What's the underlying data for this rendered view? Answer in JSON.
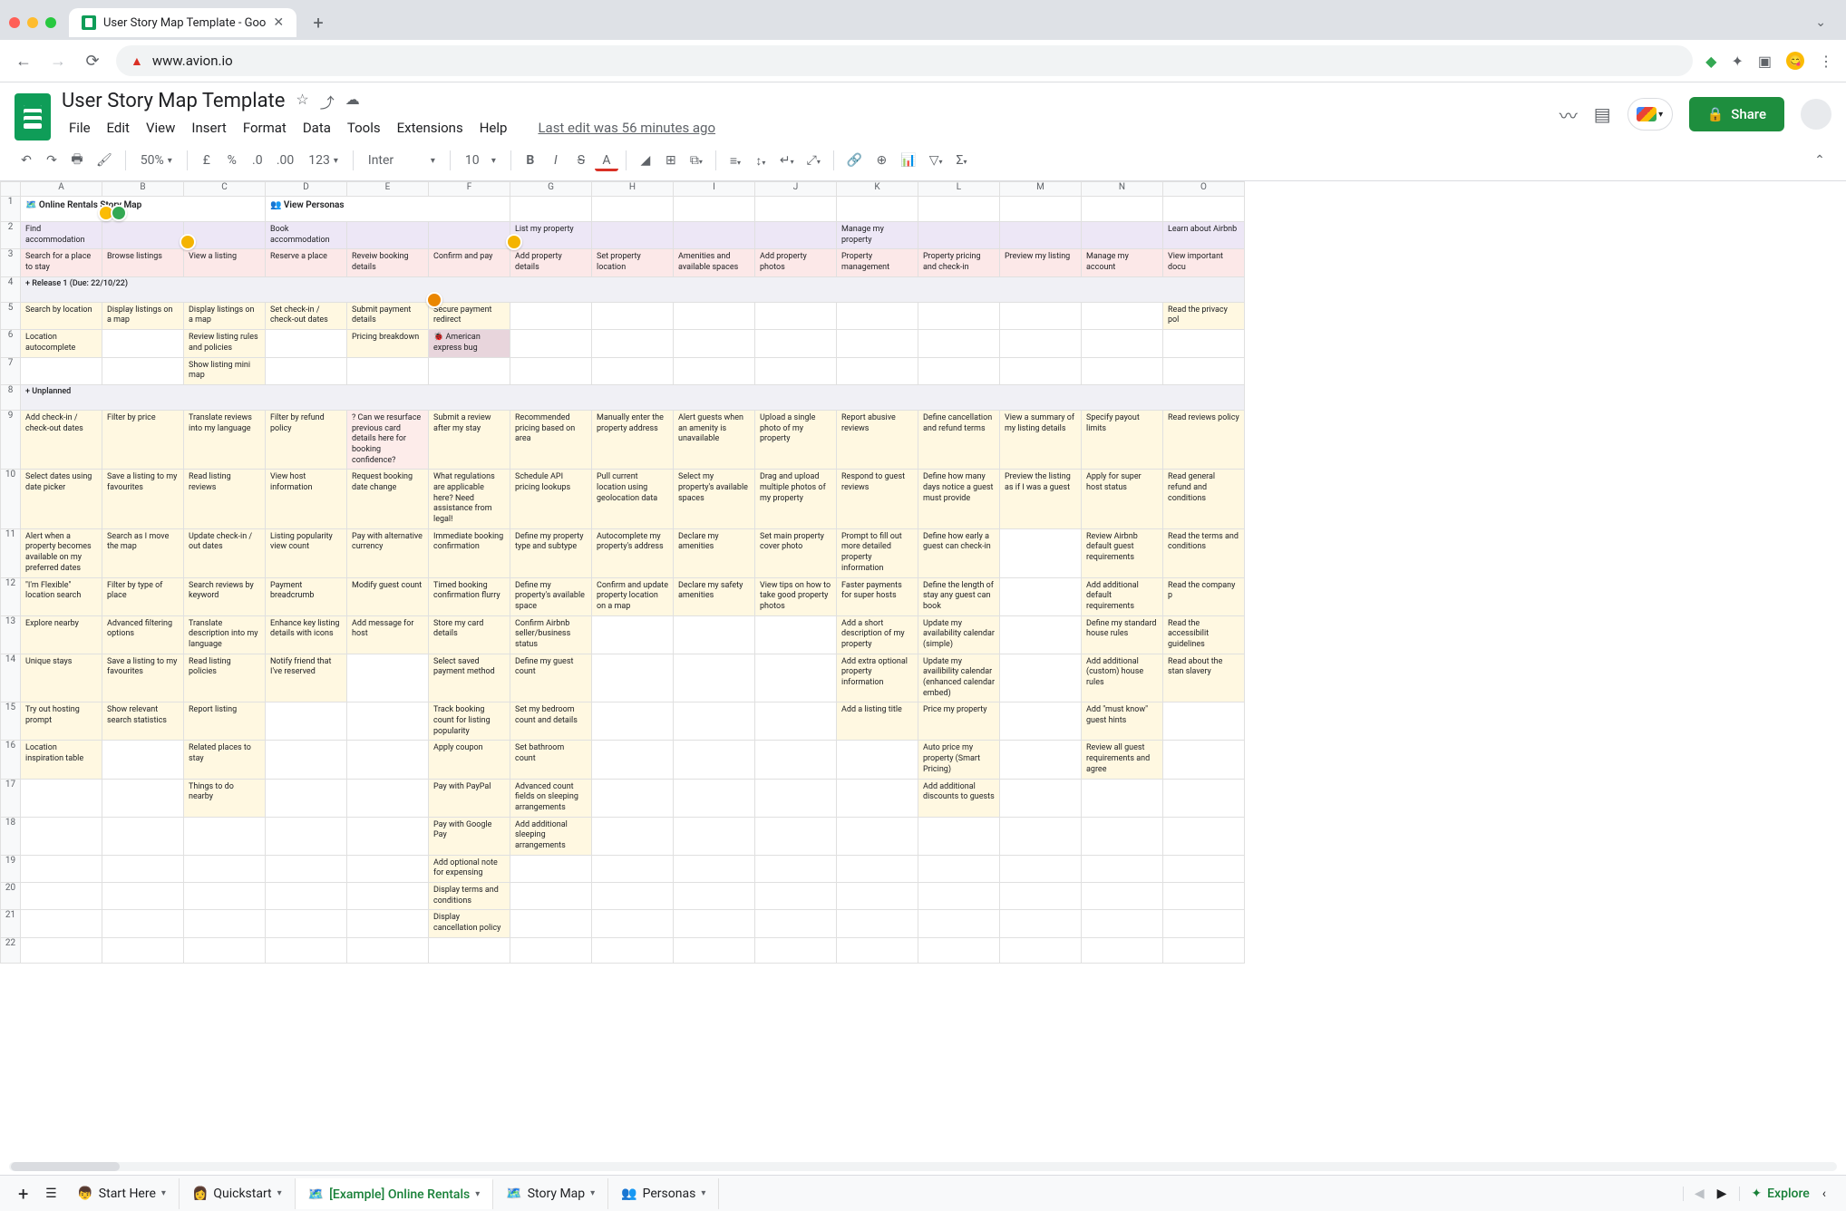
{
  "browser": {
    "tab_title": "User Story Map Template - Goo",
    "url": "www.avion.io"
  },
  "doc": {
    "title": "User Story Map Template",
    "menus": [
      "File",
      "Edit",
      "View",
      "Insert",
      "Format",
      "Data",
      "Tools",
      "Extensions",
      "Help"
    ],
    "last_edit": "Last edit was 56 minutes ago",
    "share_label": "Share"
  },
  "toolbar": {
    "zoom": "50%",
    "font": "Inter",
    "font_size": "10"
  },
  "columns": [
    "A",
    "B",
    "C",
    "D",
    "E",
    "F",
    "G",
    "H",
    "I",
    "J",
    "K",
    "L",
    "M",
    "N",
    "O"
  ],
  "map_title": "🗺️ Online Rentals Story Map",
  "personas_link": "👥 View Personas",
  "epics": [
    {
      "col": 0,
      "text": "Find accommodation"
    },
    {
      "col": 3,
      "text": "Book accommodation"
    },
    {
      "col": 6,
      "text": "List my property"
    },
    {
      "col": 10,
      "text": "Manage my property"
    },
    {
      "col": 14,
      "text": "Learn about Airbnb"
    }
  ],
  "activities": [
    "Search for a place to stay",
    "Browse listings",
    "View a listing",
    "Reserve a place",
    "Reveiw booking details",
    "Confirm and pay",
    "Add property details",
    "Set property location",
    "Amenities and available spaces",
    "Add property photos",
    "Property management",
    "Property pricing and check-in",
    "Preview my listing",
    "Manage my account",
    "View important docu"
  ],
  "release1_label": "+ Release 1 (Due: 22/10/22)",
  "release1_rows": [
    {
      "0": "Search by location",
      "1": "Display listings on a map",
      "2": "Display listings on a map",
      "3": "Set check-in / check-out dates",
      "4": "Submit payment details",
      "5": "Secure payment redirect",
      "14": "Read the privacy pol"
    },
    {
      "0": "Location autocomplete",
      "2": "Review listing rules and policies",
      "4": "Pricing breakdown",
      "5": "🐞 American express bug"
    },
    {
      "2": "Show listing mini map"
    }
  ],
  "unplanned_label": "+ Unplanned",
  "unplanned_rows": [
    {
      "0": "Add check-in / check-out dates",
      "1": "Filter by price",
      "2": "Translate reviews into my language",
      "3": "Filter by refund policy",
      "4": "? Can we resurface previous card details here for booking confidence?",
      "5": "Submit a review after my stay",
      "6": "Recommended pricing based on area",
      "7": "Manually enter the property address",
      "8": "Alert guests when an amenity is unavailable",
      "9": "Upload a single photo of my property",
      "10": "Report abusive reviews",
      "11": "Define cancellation and refund terms",
      "12": "View a summary of my listing details",
      "13": "Specify payout limits",
      "14": "Read reviews policy"
    },
    {
      "0": "Select dates using date picker",
      "1": "Save a listing to my favourites",
      "2": "Read listing reviews",
      "3": "View host information",
      "4": "Request booking date change",
      "5": "What regulations are applicable here? Need assistance from legal!",
      "6": "Schedule API pricing lookups",
      "7": "Pull current location using geolocation data",
      "8": "Select my property's available spaces",
      "9": "Drag and upload multiple photos of my property",
      "10": "Respond to guest reviews",
      "11": "Define how many days notice a guest must provide",
      "12": "Preview the listing as if I was a guest",
      "13": "Apply for super host status",
      "14": "Read general refund and conditions"
    },
    {
      "0": "Alert when a property becomes available on my preferred dates",
      "1": "Search as I move the map",
      "2": "Update check-in / out dates",
      "3": "Listing popularity view count",
      "4": "Pay with alternative currency",
      "5": "Immediate booking confirmation",
      "6": "Define my property type and subtype",
      "7": "Autocomplete my property's address",
      "8": "Declare my amenities",
      "9": "Set main property cover photo",
      "10": "Prompt to fill out more detailed property information",
      "11": "Define how early a guest can check-in",
      "13": "Review Airbnb default guest requirements",
      "14": "Read the terms and conditions"
    },
    {
      "0": "\"I'm Flexible\" location search",
      "1": "Filter by type of place",
      "2": "Search reviews by keyword",
      "3": "Payment breadcrumb",
      "4": "Modify guest count",
      "5": "Timed booking confirmation flurry",
      "6": "Define my property's available space",
      "7": "Confirm and update property location on a map",
      "8": "Declare my safety amenities",
      "9": "View tips on how to take good property photos",
      "10": "Faster payments for super hosts",
      "11": "Define the length of stay any guest can book",
      "13": "Add additional default requirements",
      "14": "Read the company p"
    },
    {
      "0": "Explore nearby",
      "1": "Advanced filtering options",
      "2": "Translate description into my language",
      "3": "Enhance key listing details with icons",
      "4": "Add message for host",
      "5": "Store my card details",
      "6": "Confirm Airbnb seller/business status",
      "10": "Add a short description of my property",
      "11": "Update my availability calendar (simple)",
      "13": "Define my standard house rules",
      "14": "Read the accessibilit guidelines"
    },
    {
      "0": "Unique stays",
      "1": "Save a listing to my favourites",
      "2": "Read listing policies",
      "3": "Notify friend that I've reserved",
      "5": "Select saved payment method",
      "6": "Define my guest count",
      "10": "Add extra optional property information",
      "11": "Update my availibility calendar (enhanced calendar embed)",
      "13": "Add additional (custom) house rules",
      "14": "Read about the stan slavery"
    },
    {
      "0": "Try out hosting prompt",
      "1": "Show relevant search statistics",
      "2": "Report listing",
      "5": "Track booking count for listing popularity",
      "6": "Set my bedroom count and details",
      "10": "Add a listing title",
      "11": "Price my property",
      "13": "Add \"must know\" guest hints"
    },
    {
      "0": "Location inspiration table",
      "2": "Related places to stay",
      "5": "Apply coupon",
      "6": "Set bathroom count",
      "11": "Auto price my property (Smart Pricing)",
      "13": "Review all guest requirements and agree"
    },
    {
      "2": "Things to do nearby",
      "5": "Pay with PayPal",
      "6": "Advanced count fields on sleeping arrangements",
      "11": "Add additional discounts to guests"
    },
    {
      "5": "Pay with Google Pay",
      "6": "Add additional sleeping arrangements"
    },
    {
      "5": "Add optional note for expensing"
    },
    {
      "5": "Display terms and conditions"
    },
    {
      "5": "Display cancellation policy"
    }
  ],
  "sheet_tabs": [
    {
      "icon": "👦",
      "label": "Start Here"
    },
    {
      "icon": "👩",
      "label": "Quickstart"
    },
    {
      "icon": "🗺️",
      "label": "[Example] Online Rentals",
      "active": true
    },
    {
      "icon": "🗺️",
      "label": "Story Map"
    },
    {
      "icon": "👥",
      "label": "Personas"
    }
  ],
  "explore_label": "Explore"
}
